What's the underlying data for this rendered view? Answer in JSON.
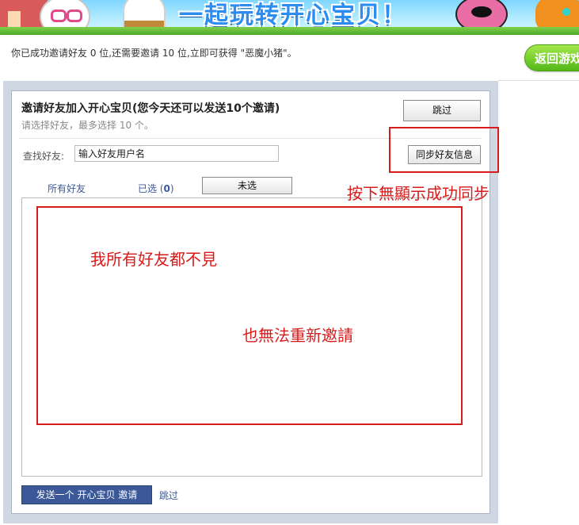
{
  "banner": {
    "logo_text": "一起玩转开心宝贝！"
  },
  "notice": {
    "text": "你已成功邀请好友 0 位,还需要邀请 10 位,立即可获得 \"恶魔小猪\"。"
  },
  "return_button": {
    "label": "返回游戏"
  },
  "dialog": {
    "title": "邀请好友加入开心宝贝(您今天还可以发送10个邀请)",
    "subtitle": "请选择好友，最多选择 10 个。",
    "skip_label": "跳过",
    "search_label": "查找好友:",
    "search_value": "输入好友用户名",
    "sync_label": "同步好友信息",
    "tabs": {
      "all": "所有好友",
      "selected_prefix": "已选 (",
      "selected_count": "0",
      "selected_suffix": ")",
      "unselected": "未选"
    },
    "send_label": "发送一个 开心宝贝 邀请",
    "skip_bottom_label": "跳过"
  },
  "annotations": {
    "sync_note": "按下無顯示成功同步",
    "friends_missing": "我所有好友都不見",
    "cannot_invite": "也無法重新邀請"
  },
  "colors": {
    "annotation_red": "#d81b1b",
    "link_blue": "#3b5998",
    "send_button_bg": "#3b5998"
  }
}
